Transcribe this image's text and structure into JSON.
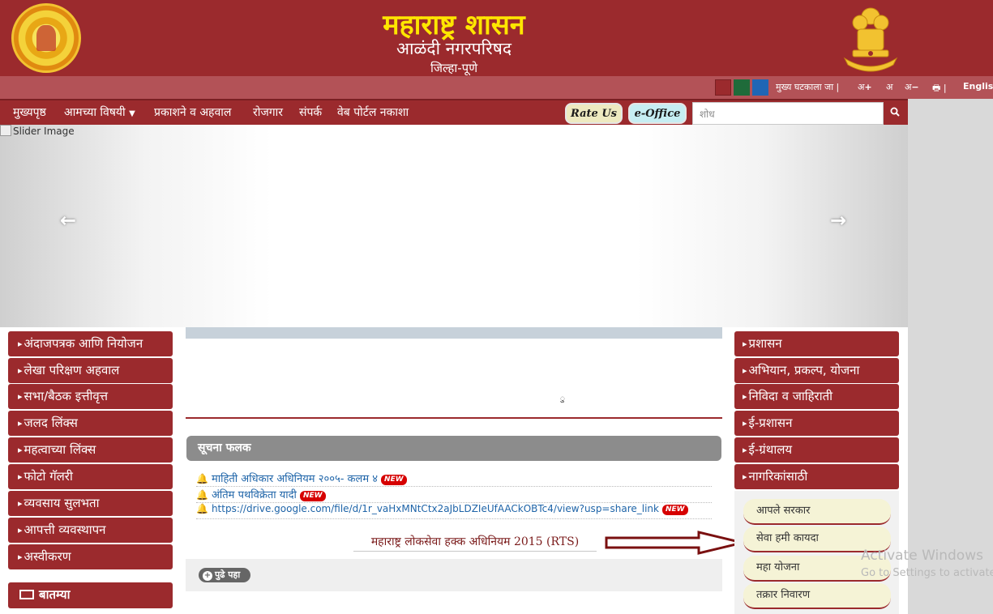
{
  "header": {
    "title": "महाराष्ट्र शासन",
    "subtitle": "आळंदी नगरपरिषद",
    "district": "जिल्हा-पूणे"
  },
  "utility": {
    "swatches": [
      "#9b2a2d",
      "#1f6b3a",
      "#1f66b5"
    ],
    "main_event": "मुख्य घटकाला जा |",
    "font_plus": "अ",
    "font_normal": "अ",
    "font_minus": "अ",
    "separator": "|",
    "language": "English"
  },
  "nav": {
    "items": [
      "मुख्यपृष्ठ",
      "आमच्या विषयी",
      "प्रकाशने व अहवाल",
      "रोजगार",
      "संपर्क",
      "वेब पोर्टल नकाशा"
    ],
    "rate_us": "Rate Us",
    "eoffice": "e-Office",
    "search_placeholder": "शोध"
  },
  "slider": {
    "alt_text": "Slider Image"
  },
  "left_menu": [
    "अंदाजपत्रक आणि नियोजन",
    "लेखा परिक्षण अहवाल",
    "सभा/बैठक इत्तीवृत्त",
    "जलद लिंक्स",
    "महत्वाच्या लिंक्स",
    "फोटो गॅलरी",
    "व्यवसाय सुलभता",
    "आपत्ती व्यवस्थापन",
    "अस्वीकरण"
  ],
  "news": {
    "label": "बातम्या"
  },
  "center": {
    "dot": "ु",
    "notice_title": "सूचना फलक",
    "notices": [
      {
        "text": "माहिती अधिकार अधिनियम २००५- कलम ४",
        "badge": "NEW"
      },
      {
        "text": "अंतिम पथविक्रेता यादी",
        "badge": "NEW"
      },
      {
        "text": "https://drive.google.com/file/d/1r_vaHxMNtCtx2aJbLDZIeUfAACkOBTc4/view?usp=share_link",
        "badge": "NEW"
      }
    ],
    "rts_text": "महाराष्ट्र लोकसेवा हक्क अधिनियम 2015 (RTS)",
    "more_label": "पुढे पहा"
  },
  "right_menu": [
    "प्रशासन",
    "अभियान, प्रकल्प, योजना",
    "निविदा व जाहिराती",
    "ई-प्रशासन",
    "ई-ग्रंथालय",
    "नागरिकांसाठी"
  ],
  "services": [
    "आपले सरकार",
    "सेवा हमी कायदा",
    "महा योजना",
    "तक्रार निवारण"
  ],
  "watermark": {
    "line1": "Activate Windows",
    "line2": "Go to Settings to activate"
  }
}
